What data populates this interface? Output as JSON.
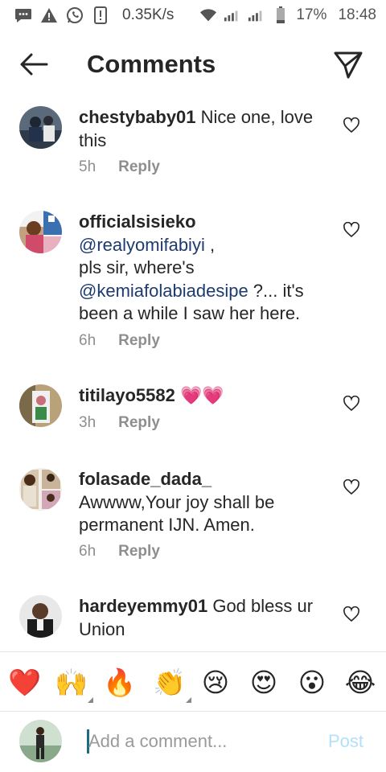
{
  "status_bar": {
    "speed": "0.35K/s",
    "battery": "17%",
    "time": "18:48",
    "icons": [
      "messages-icon",
      "warning-icon",
      "whatsapp-icon",
      "notification-icon",
      "wifi-icon",
      "signal-icon",
      "signal-icon",
      "battery-icon"
    ]
  },
  "header": {
    "back_icon": "arrow-left-icon",
    "title": "Comments",
    "send_icon": "paper-plane-icon"
  },
  "comments": [
    {
      "username": "chestybaby01",
      "text": " Nice one, love this",
      "time": "5h",
      "reply_label": "Reply"
    },
    {
      "username": "officialsisieko",
      "mention1": "@realyomifabiyi",
      "text_after_mention1": " ,",
      "text_line2": "pls sir, where's",
      "mention2": "@kemiafolabiadesipe",
      "text_after_mention2": " ?... it's been a while I saw her here.",
      "time": "6h",
      "reply_label": "Reply"
    },
    {
      "username": "titilayo5582",
      "text": " 💗💗",
      "time": "3h",
      "reply_label": "Reply"
    },
    {
      "username": "folasade_dada_",
      "text": "Awwww,Your joy shall be permanent IJN. Amen.",
      "time": "6h",
      "reply_label": "Reply"
    },
    {
      "username": "hardeyemmy01",
      "text": " God bless ur Union"
    }
  ],
  "emoji_bar": [
    "❤️",
    "🙌",
    "🔥",
    "👏",
    "😢",
    "😍",
    "😮",
    "😂"
  ],
  "input": {
    "placeholder": "Add a comment...",
    "post_label": "Post"
  },
  "colors": {
    "mention": "#1d3b6e",
    "post_disabled": "#b2dffc",
    "heart": "#e9437a"
  }
}
